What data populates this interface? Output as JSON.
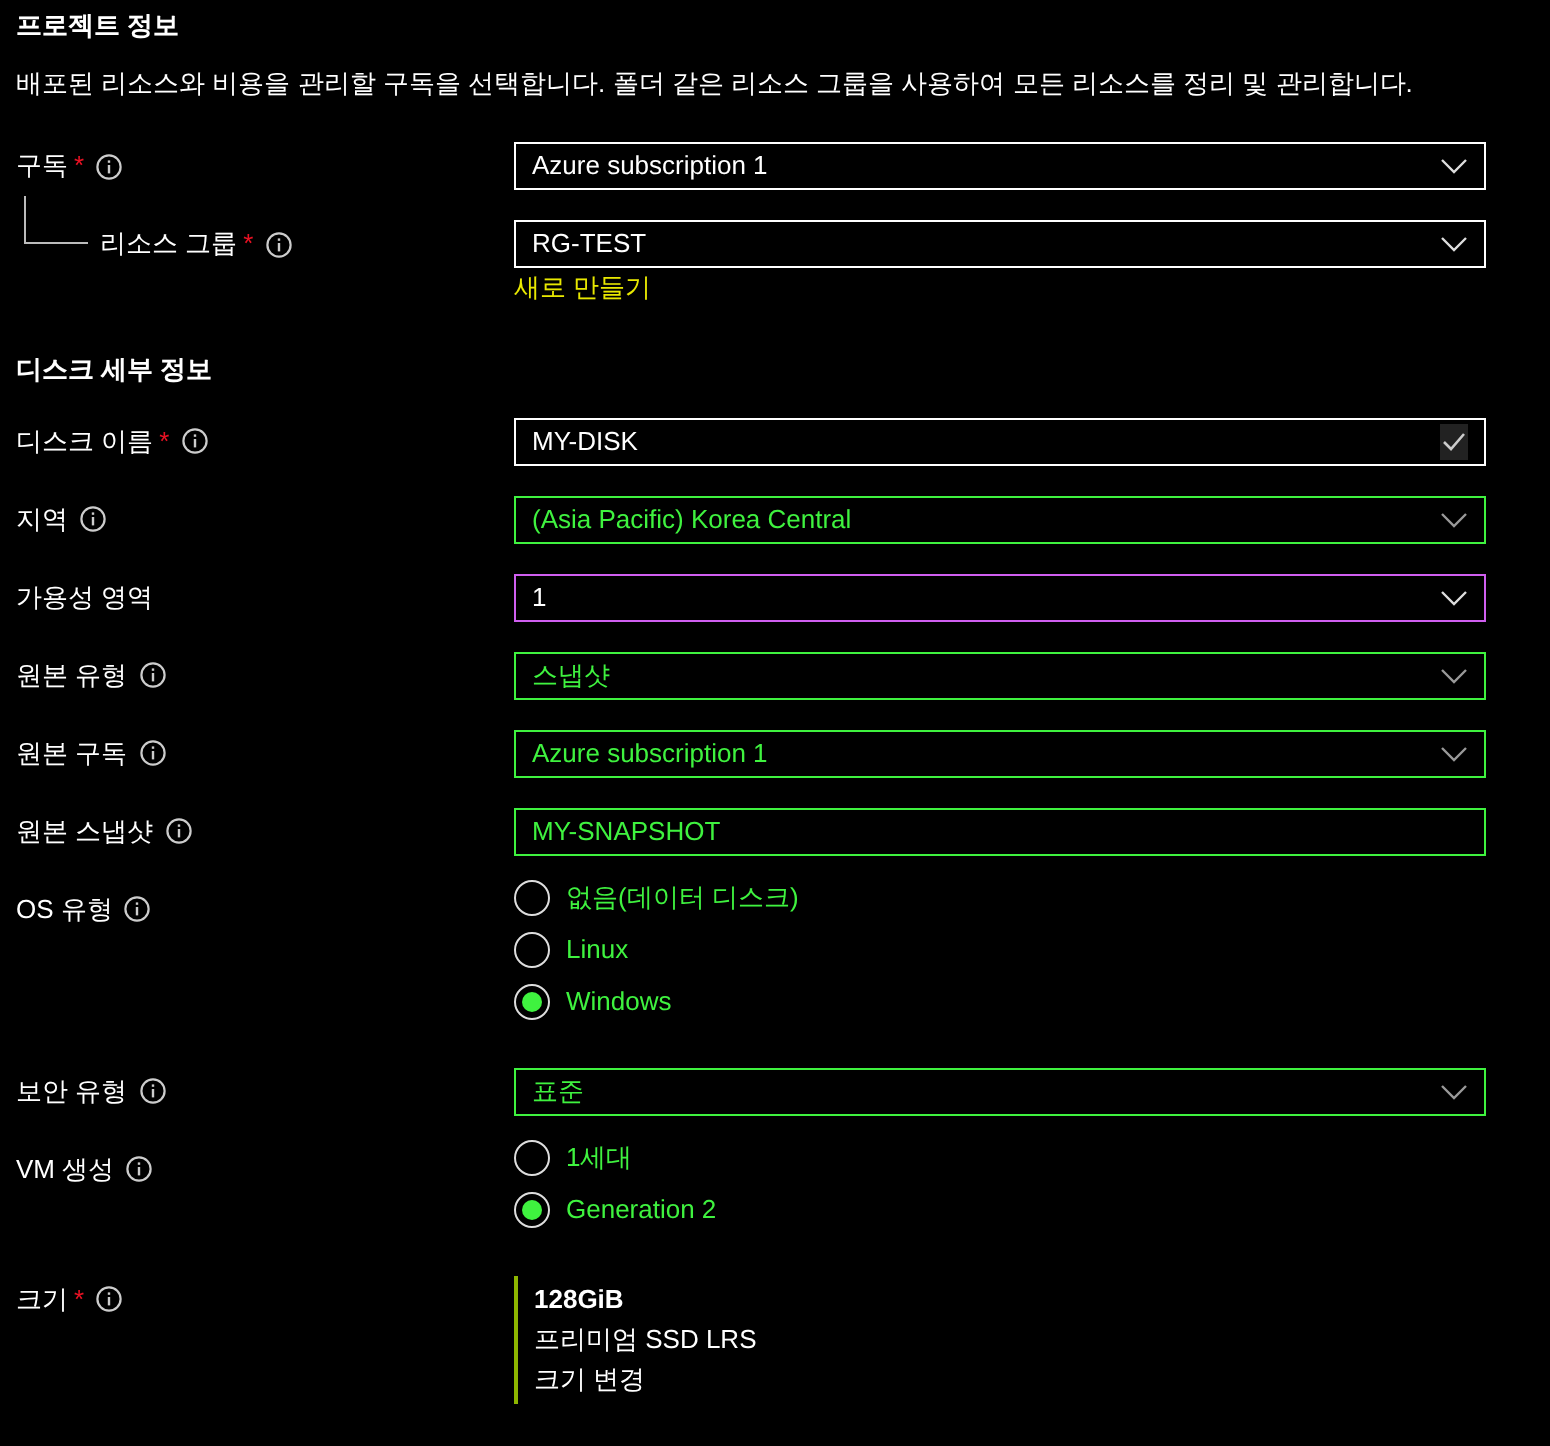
{
  "sections": [
    {
      "title": "프로젝트 정보",
      "description": "배포된 리소스와 비용을 관리할 구독을 선택합니다. 폴더 같은 리소스 그룹을 사용하여 모든 리소스를 정리 및 관리합니다.",
      "rows": [
        {
          "label": "구독",
          "required_mark": "*",
          "info": true,
          "field": {
            "kind": "dropdown",
            "value": "Azure subscription 1",
            "disabled": false,
            "focused": false
          },
          "children": [
            {
              "label": "리소스 그룹",
              "required_mark": "*",
              "info": true,
              "field": {
                "kind": "dropdown",
                "value": "RG-TEST",
                "disabled": false,
                "focused": false,
                "link": "새로 만들기"
              }
            }
          ]
        }
      ]
    },
    {
      "title": "디스크 세부 정보",
      "rows": [
        {
          "label": "디스크 이름",
          "required_mark": "*",
          "info": true,
          "field": {
            "kind": "textbox",
            "value": "MY-DISK",
            "disabled": false,
            "focused": false,
            "validated": true
          }
        },
        {
          "label": "지역",
          "info": true,
          "field": {
            "kind": "dropdown",
            "value": "(Asia Pacific) Korea Central",
            "disabled": true,
            "focused": false
          }
        },
        {
          "label": "가용성 영역",
          "info": false,
          "field": {
            "kind": "dropdown",
            "value": "1",
            "disabled": false,
            "focused": true
          }
        },
        {
          "label": "원본 유형",
          "info": true,
          "field": {
            "kind": "dropdown",
            "value": "스냅샷",
            "disabled": true,
            "focused": false
          }
        },
        {
          "label": "원본 구독",
          "info": true,
          "field": {
            "kind": "dropdown",
            "value": "Azure subscription 1",
            "disabled": true,
            "focused": false
          }
        },
        {
          "label": "원본 스냅샷",
          "info": true,
          "field": {
            "kind": "textbox",
            "value": "MY-SNAPSHOT",
            "disabled": true,
            "focused": false
          }
        },
        {
          "label": "OS 유형",
          "info": true,
          "field": {
            "kind": "radio",
            "disabled": true,
            "options": [
              {
                "label": "없음(데이터 디스크)",
                "selected": false
              },
              {
                "label": "Linux",
                "selected": false
              },
              {
                "label": "Windows",
                "selected": true
              }
            ]
          }
        },
        {
          "label": "보안 유형",
          "info": true,
          "field": {
            "kind": "dropdown",
            "value": "표준",
            "disabled": true,
            "focused": false
          }
        },
        {
          "label": "VM 생성",
          "info": true,
          "field": {
            "kind": "radio",
            "disabled": true,
            "options": [
              {
                "label": "1세대",
                "selected": false
              },
              {
                "label": "Generation 2",
                "selected": true
              }
            ]
          }
        },
        {
          "label": "크기",
          "required_mark": "*",
          "info": true,
          "field": {
            "kind": "summary",
            "title": "128GiB",
            "lines": [
              "프리미엄 SSD LRS"
            ],
            "link": "크기 변경"
          }
        }
      ]
    }
  ]
}
